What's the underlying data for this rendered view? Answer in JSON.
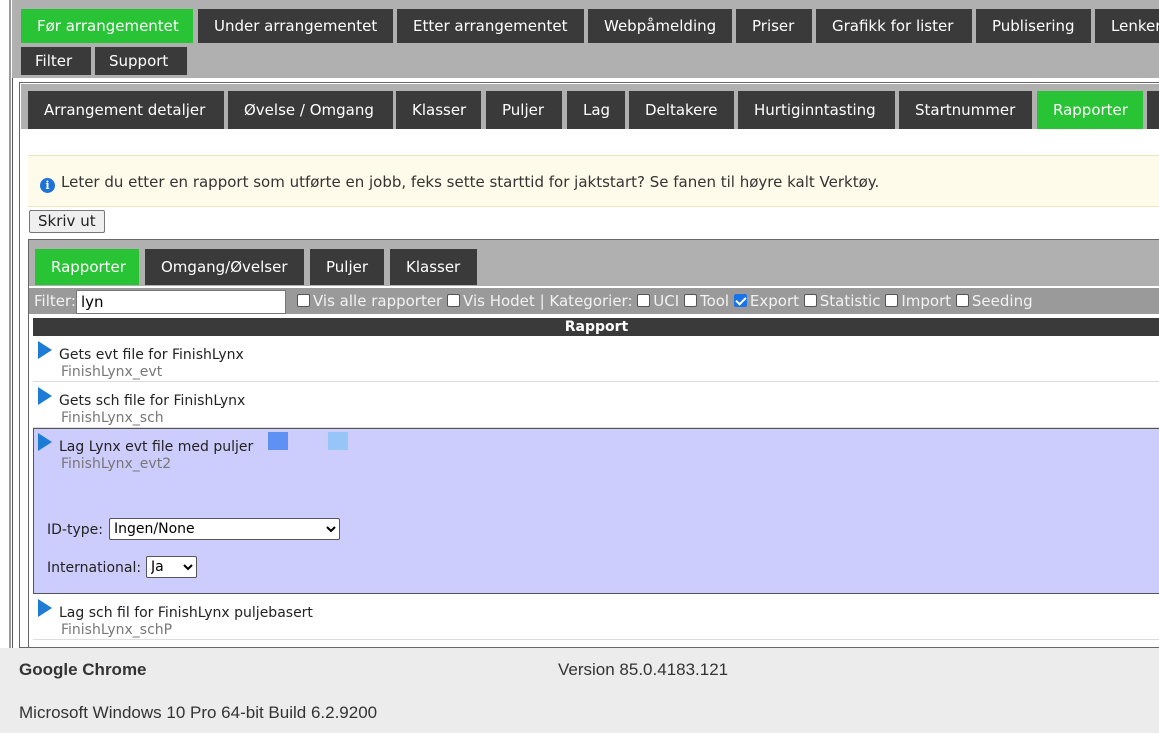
{
  "top_tabs": [
    "Før arrangementet",
    "Under arrangementet",
    "Etter arrangementet",
    "Webpåmelding",
    "Priser",
    "Grafikk for lister",
    "Publisering",
    "Lenker"
  ],
  "top_tabs_row2": [
    "Filter",
    "Support"
  ],
  "sub_tabs": [
    "Arrangement detaljer",
    "Øvelse / Omgang",
    "Klasser",
    "Puljer",
    "Lag",
    "Deltakere",
    "Hurtiginntasting",
    "Startnummer",
    "Rapporter"
  ],
  "info_message": "Leter du etter en rapport som utførte en jobb, feks sette starttid for jaktstart? Se fanen til høyre kalt Verktøy.",
  "print_button": "Skriv ut",
  "report_tabs": [
    "Rapporter",
    "Omgang/Øvelser",
    "Puljer",
    "Klasser"
  ],
  "filter": {
    "label": "Filter:",
    "value": "lyn",
    "show_all": "Vis alle rapporter",
    "show_header": "Vis Hodet",
    "separator": "|",
    "categories_label": "Kategorier:",
    "categories": [
      {
        "name": "UCI",
        "checked": false
      },
      {
        "name": "Tool",
        "checked": false
      },
      {
        "name": "Export",
        "checked": true
      },
      {
        "name": "Statistic",
        "checked": false
      },
      {
        "name": "Import",
        "checked": false
      },
      {
        "name": "Seeding",
        "checked": false
      }
    ]
  },
  "column_header": "Rapport",
  "reports": [
    {
      "title": "Gets evt file for FinishLynx",
      "subtitle": "FinishLynx_evt"
    },
    {
      "title": "Gets sch file for FinishLynx",
      "subtitle": "FinishLynx_sch"
    },
    {
      "title": "Lag Lynx evt file med puljer",
      "subtitle": "FinishLynx_evt2"
    },
    {
      "title": "Lag sch fil for FinishLynx puljebasert",
      "subtitle": "FinishLynx_schP"
    }
  ],
  "selected_report": {
    "id_type_label": "ID-type:",
    "id_type_value": "Ingen/None",
    "international_label": "International:",
    "international_value": "Ja"
  },
  "footer": {
    "app_name": "Google Chrome",
    "version": "Version 85.0.4183.121",
    "os": "Microsoft Windows 10 Pro 64-bit Build 6.2.9200"
  },
  "colors": {
    "active_tab": "#29c435",
    "tab": "#3a3a3a",
    "selected_row": "#cccdfc",
    "arrow": "#1e7bd6"
  }
}
